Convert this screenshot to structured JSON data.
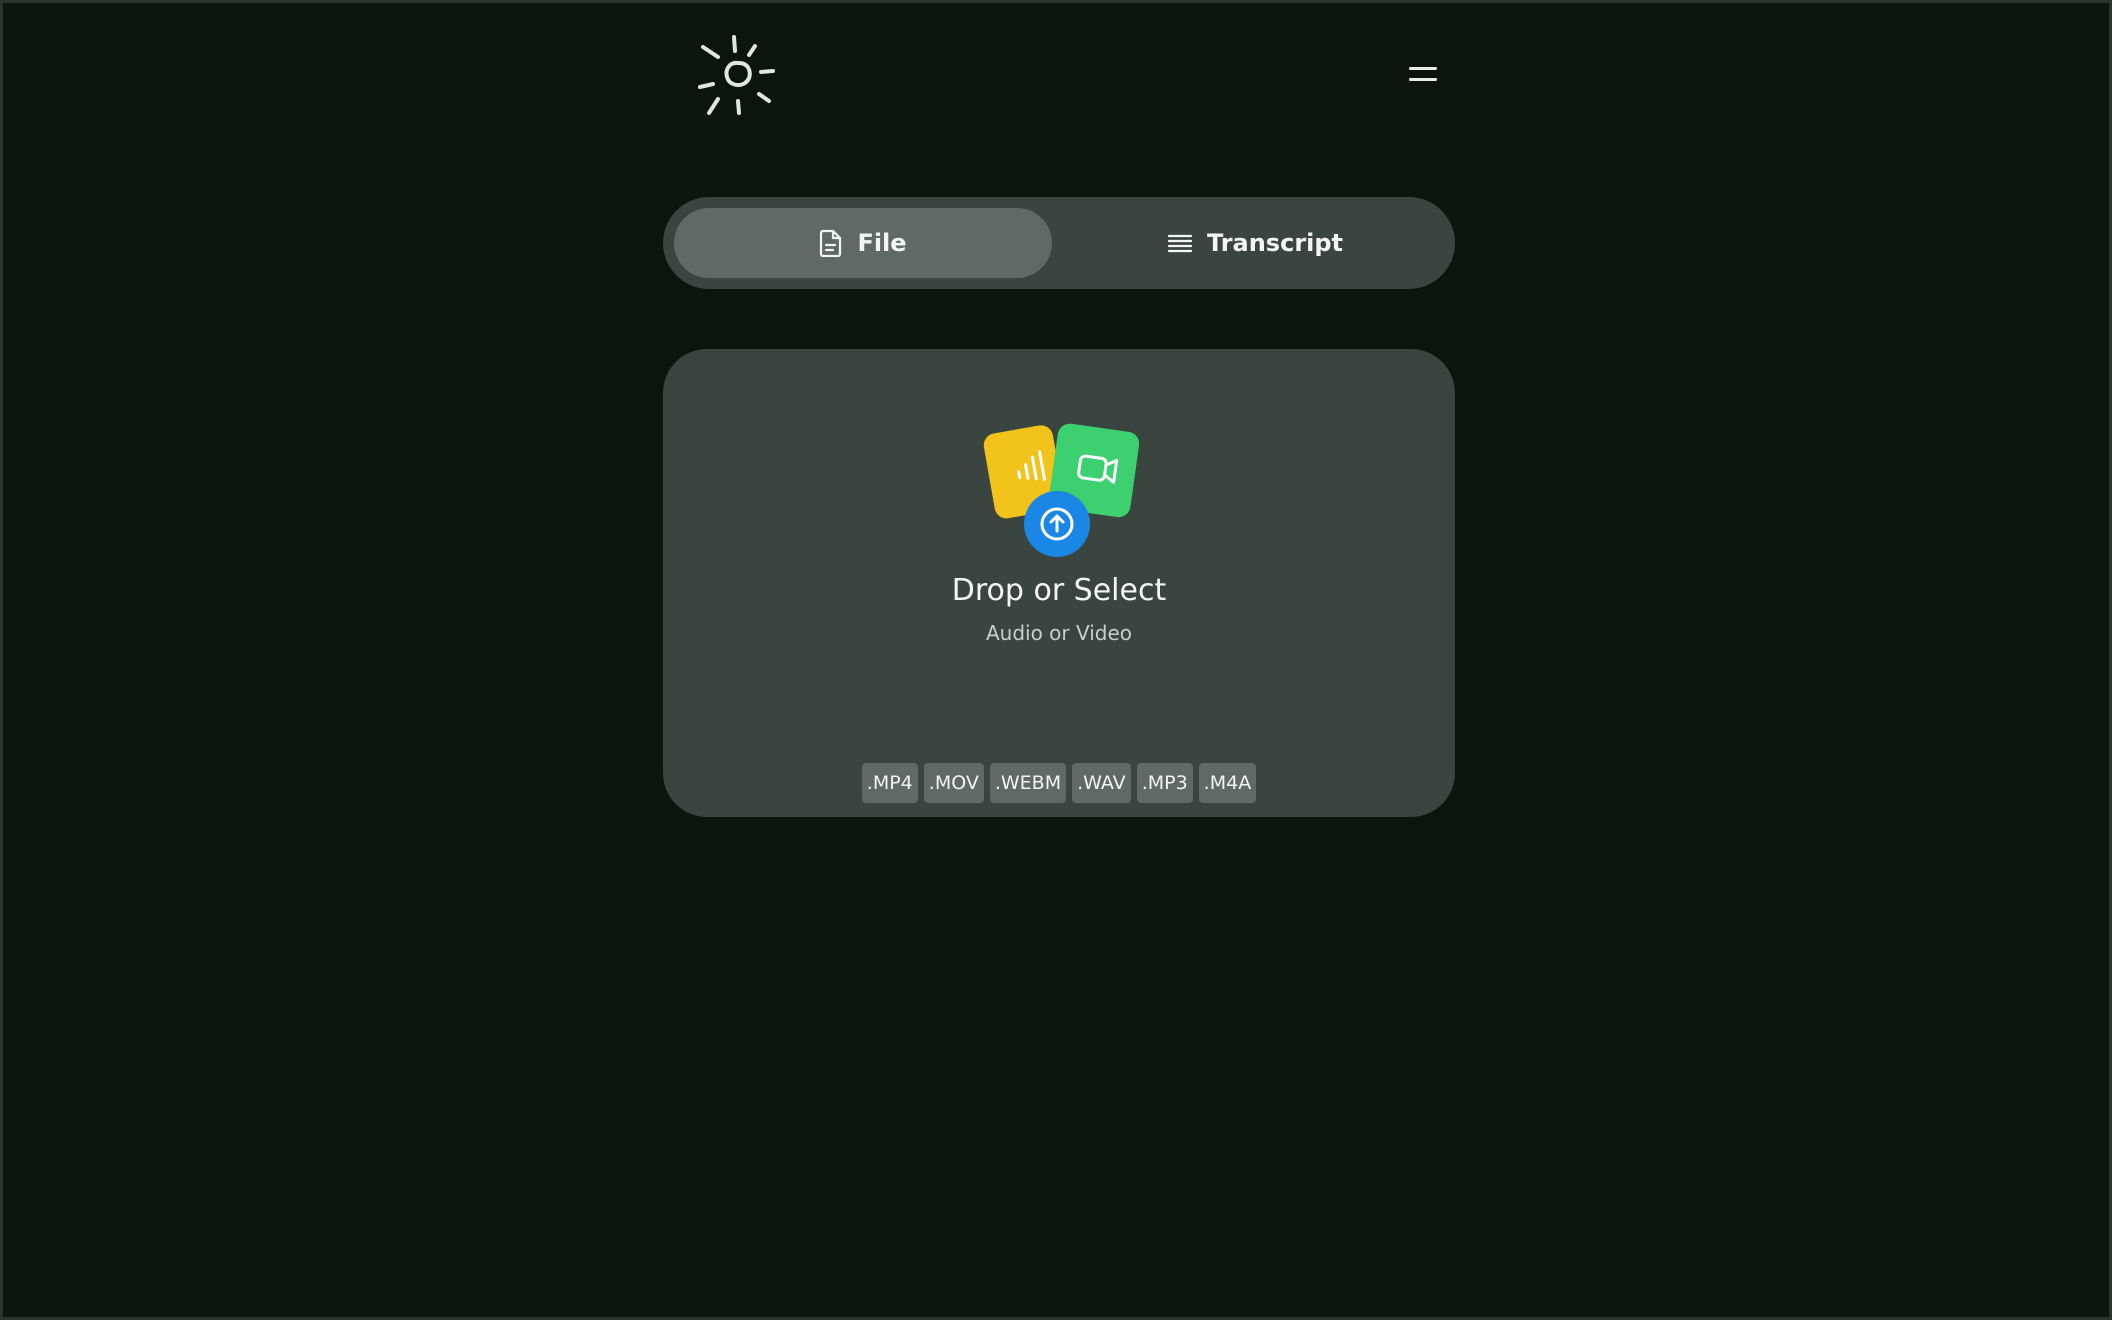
{
  "header": {
    "logo_icon": "sun-logo-icon",
    "menu_icon": "hamburger-menu-icon"
  },
  "tabs": [
    {
      "label": "File",
      "icon": "file-icon",
      "active": true
    },
    {
      "label": "Transcript",
      "icon": "lines-icon",
      "active": false
    }
  ],
  "dropzone": {
    "title": "Drop or Select",
    "subtitle": "Audio or Video",
    "icons": [
      "audio-card-icon",
      "video-card-icon",
      "upload-arrow-icon"
    ],
    "formats": [
      ".MP4",
      ".MOV",
      ".WEBM",
      ".WAV",
      ".MP3",
      ".M4A"
    ]
  },
  "colors": {
    "background": "#0b150e",
    "panel": "#3b4540",
    "active_tab": "#5e6a63",
    "audio_card": "#f2c31a",
    "video_card": "#3dd070",
    "upload_button": "#1a86e6"
  }
}
